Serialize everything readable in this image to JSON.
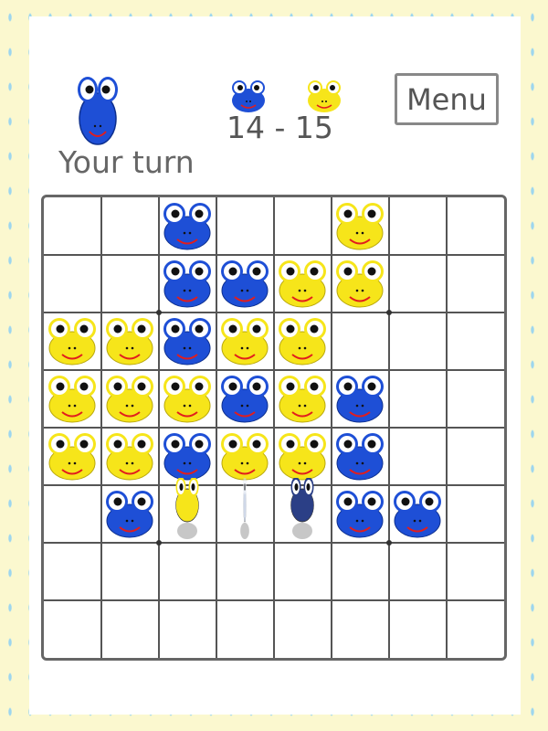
{
  "status_text": "Your turn",
  "score": {
    "blue": "14",
    "separator": "-",
    "yellow": "15"
  },
  "menu_label": "Menu",
  "current_player": "blue",
  "colors": {
    "blue": "#1e4fd6",
    "yellow": "#f6e51a",
    "grid": "#555555",
    "background": "#fbf8cf",
    "raindrop": "#9dd6ee"
  },
  "board": {
    "size": 8,
    "cells": [
      [
        "",
        "",
        "blue",
        "",
        "",
        "yellow",
        "",
        ""
      ],
      [
        "",
        "",
        "blue",
        "blue",
        "yellow",
        "yellow",
        "",
        ""
      ],
      [
        "yellow",
        "yellow",
        "blue",
        "yellow",
        "yellow",
        "",
        "",
        ""
      ],
      [
        "yellow",
        "yellow",
        "yellow",
        "blue",
        "yellow",
        "blue",
        "",
        ""
      ],
      [
        "yellow",
        "yellow",
        "blue",
        "yellow",
        "yellow",
        "blue",
        "",
        ""
      ],
      [
        "",
        "blue",
        "flip-yellow",
        "flip-edge",
        "flip-blue",
        "blue",
        "blue",
        ""
      ],
      [
        "",
        "",
        "",
        "",
        "",
        "",
        "",
        ""
      ],
      [
        "",
        "",
        "",
        "",
        "",
        "",
        "",
        ""
      ]
    ]
  }
}
